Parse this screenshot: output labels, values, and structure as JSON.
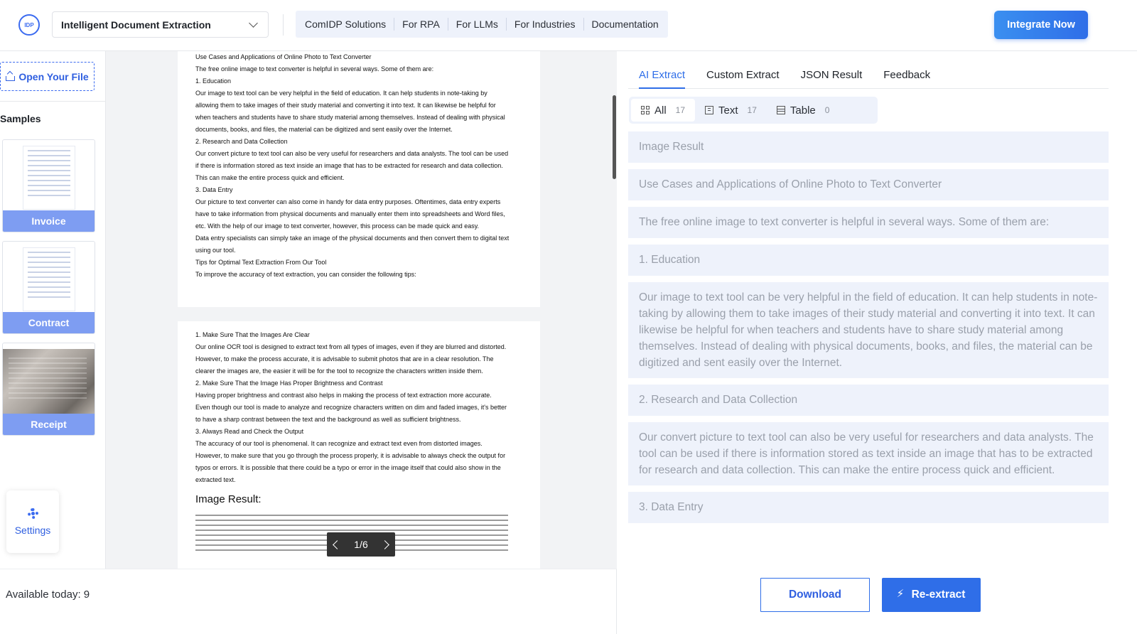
{
  "header": {
    "logo_text": "IDP",
    "product_select": "Intelligent Document Extraction",
    "nav": [
      "ComIDP Solutions",
      "For RPA",
      "For LLMs",
      "For Industries",
      "Documentation"
    ],
    "cta": "Integrate Now"
  },
  "sidebar": {
    "open_file": "Open Your File",
    "samples_title": "Samples",
    "samples": [
      {
        "label": "Invoice"
      },
      {
        "label": "Contract"
      },
      {
        "label": "Receipt"
      }
    ],
    "settings": "Settings"
  },
  "viewer": {
    "page1": [
      "Use Cases and Applications of Online Photo to Text Converter",
      "The free online image to text converter is helpful in several ways. Some of them are:",
      "1. Education",
      "Our image to text tool can be very helpful in the field of education. It can help students in note-taking by",
      "allowing them to take images of their study material and converting it into text. It can likewise be helpful for",
      "when teachers and students have to share study material among themselves. Instead of dealing with physical",
      "documents, books, and files, the material can be digitized and sent easily over the Internet.",
      "2. Research and Data Collection",
      "Our convert picture to text tool can also be very useful for researchers and data analysts. The tool can be used",
      "if there is information stored as text inside an image that has to be extracted for research and data collection.",
      "This can make the entire process quick and efficient.",
      "3. Data Entry",
      "Our picture to text converter can also come in handy for data entry purposes. Oftentimes, data entry experts",
      "have to take information from physical documents and manually enter them into spreadsheets and Word files,",
      "etc. With the help of our image to text converter, however, this process can be made quick and easy.",
      "Data entry specialists can simply take an image of the physical documents and then convert them to digital text",
      "using our tool.",
      "Tips for Optimal Text Extraction From Our Tool",
      "To improve the accuracy of text extraction, you can consider the following tips:"
    ],
    "page2": [
      "1. Make Sure That the Images Are Clear",
      "Our online OCR tool is designed to extract text from all types of images, even if they are blurred and distorted.",
      "However, to make the process accurate, it is advisable to submit photos that are in a clear resolution. The",
      "clearer the images are, the easier it will be for the tool to recognize the characters written inside them.",
      "2. Make Sure That the Image Has Proper Brightness and Contrast",
      "Having proper brightness and contrast also helps in making the process of text extraction more accurate.",
      "Even though our tool is made to analyze and recognize characters written on dim and faded images, it's better",
      "to have a sharp contrast between the text and the background as well as sufficient brightness.",
      "3. Always Read and Check the Output",
      "The accuracy of our tool is phenomenal. It can recognize and extract text even from distorted images.",
      "However, to make sure that you go through the process properly, it is advisable to always check the output for",
      "typos or errors. It is possible that there could be a typo or error in the image itself that could also show in the",
      "extracted text."
    ],
    "page2_heading": "Image Result:",
    "pager": "1/6"
  },
  "footer": {
    "available": "Available today: 9",
    "download": "Download",
    "reextract": "Re-extract"
  },
  "results": {
    "tabs": [
      "AI Extract",
      "Custom Extract",
      "JSON Result",
      "Feedback"
    ],
    "filters": [
      {
        "label": "All",
        "count": "17"
      },
      {
        "label": "Text",
        "count": "17"
      },
      {
        "label": "Table",
        "count": "0"
      }
    ],
    "blocks": [
      "Image Result",
      "Use Cases and Applications of Online Photo to Text Converter",
      "The free online image to text converter is helpful in several ways. Some of them are:",
      "1. Education",
      "Our image to text tool can be very helpful in the field of education. It can help students in note-taking by allowing them to take images of their study material and converting it into text. It can likewise be helpful for when teachers and students have to share study material among themselves. Instead of dealing with physical documents, books, and files, the material can be digitized and sent easily over the Internet.",
      "2. Research and Data Collection",
      "Our convert picture to text tool can also be very useful for researchers and data analysts. The tool can be used if there is information stored as text inside an image that has to be extracted for research and data collection. This can make the entire process quick and efficient.",
      "3. Data Entry"
    ]
  }
}
